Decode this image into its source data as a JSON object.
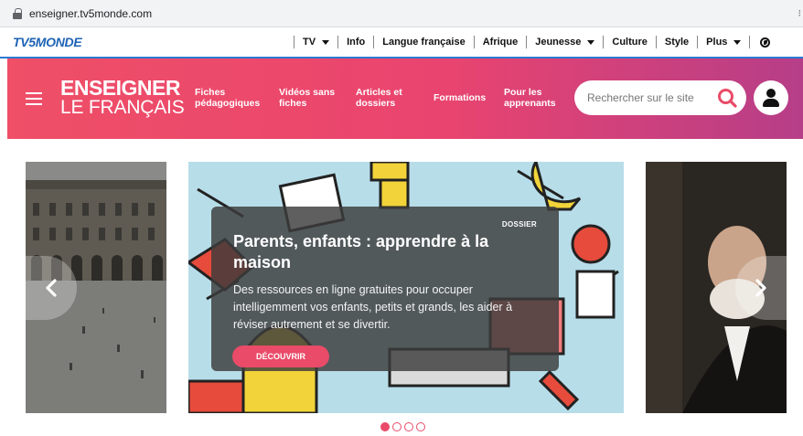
{
  "browser": {
    "url": "enseigner.tv5monde.com"
  },
  "tv5_nav": {
    "logo": "TV5MONDE",
    "items": [
      {
        "label": "TV",
        "dropdown": true
      },
      {
        "label": "Info",
        "dropdown": false
      },
      {
        "label": "Langue française",
        "dropdown": false
      },
      {
        "label": "Afrique",
        "dropdown": false
      },
      {
        "label": "Jeunesse",
        "dropdown": true
      },
      {
        "label": "Culture",
        "dropdown": false
      },
      {
        "label": "Style",
        "dropdown": false
      },
      {
        "label": "Plus",
        "dropdown": true
      }
    ]
  },
  "header": {
    "brand_line1": "ENSEIGNER",
    "brand_line2": "LE FRANÇAIS",
    "nav": [
      {
        "line1": "Fiches",
        "line2": "pédagogiques"
      },
      {
        "line1": "Vidéos sans",
        "line2": "fiches"
      },
      {
        "line1": "Articles et",
        "line2": "dossiers"
      },
      {
        "line1": "Formations",
        "line2": ""
      },
      {
        "line1": "Pour les",
        "line2": "apprenants"
      }
    ],
    "search_placeholder": "Rechercher sur le site"
  },
  "carousel": {
    "tag": "DOSSIER",
    "title": "Parents, enfants : apprendre à la maison",
    "description": "Des ressources en ligne gratuites pour occuper intelligemment vos enfants, petits et grands, les aider à réviser autrement et se divertir.",
    "cta": "DÉCOUVRIR",
    "slide_count": 4,
    "active_slide": 1
  },
  "colors": {
    "tv5_blue": "#1e63b5",
    "accent_pink": "#e94b68",
    "header_gradient_end": "#b63e88"
  }
}
